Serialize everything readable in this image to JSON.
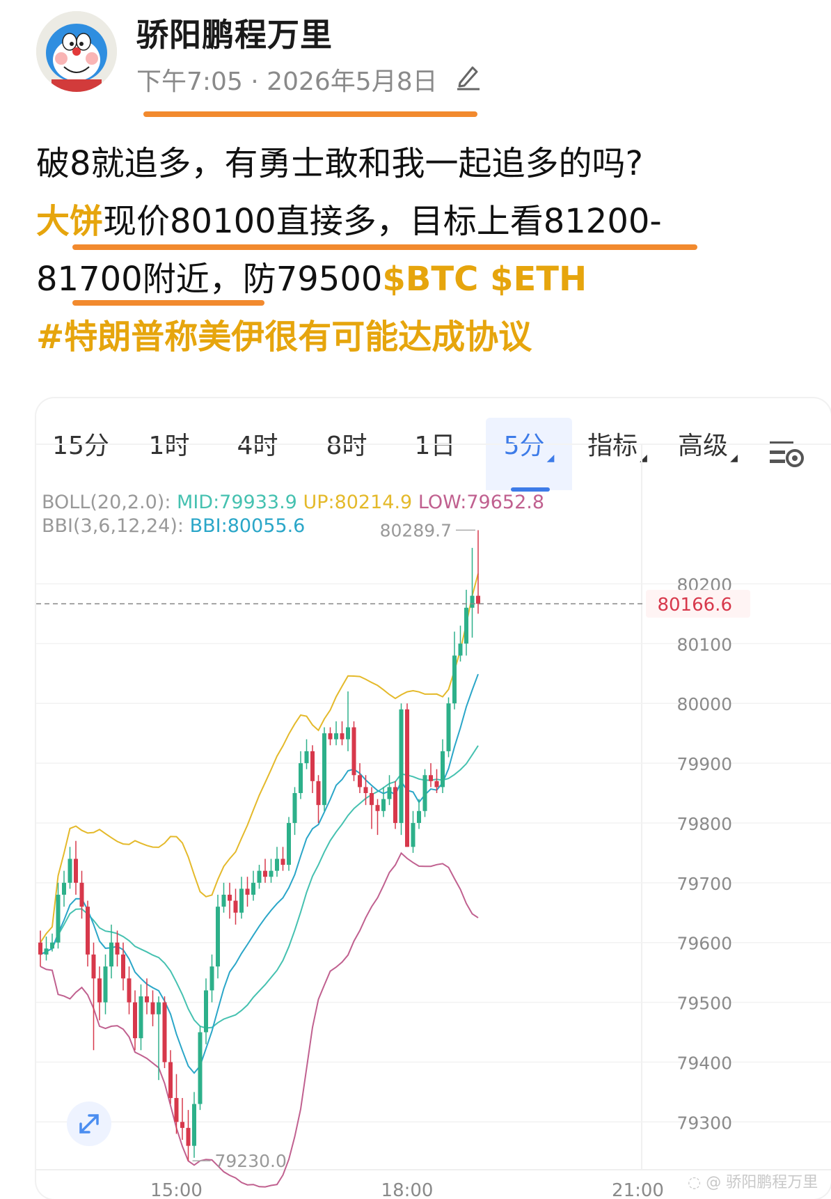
{
  "post": {
    "author": "骄阳鹏程万里",
    "meta": "下午7:05 · 2026年5月8日",
    "line1": "破8就追多，有勇士敢和我一起追多的吗?",
    "line2_hl": "大饼",
    "line2": "现价80100直接多，目标上看81200-",
    "line3": "81700附近，防79500",
    "line3_tags": "$BTC $ETH",
    "line4": "#特朗普称美伊很有可能达成协议"
  },
  "tabs": [
    {
      "label": "15分"
    },
    {
      "label": "1时"
    },
    {
      "label": "4时"
    },
    {
      "label": "8时"
    },
    {
      "label": "1日"
    },
    {
      "label": "5分",
      "active": true,
      "caret": true
    },
    {
      "label": "指标",
      "caret": true
    },
    {
      "label": "高级",
      "caret": true
    }
  ],
  "indicators": {
    "boll_label": "BOLL(20,2.0):",
    "boll_mid": "MID:79933.9",
    "boll_up": "UP:80214.9",
    "boll_low": "LOW:79652.8",
    "bbi_label": "BBI(3,6,12,24):",
    "bbi_value": "BBI:80055.6"
  },
  "colors": {
    "up": "#2db08a",
    "down": "#d7384b",
    "mid": "#45c1b0",
    "upper": "#e4b92a",
    "lower": "#c0608f",
    "bbi": "#2aa6c8",
    "accent": "#3d7be8",
    "gold": "#e6a50d",
    "highlight": "#f28a2e"
  },
  "chart_data": {
    "type": "candlestick",
    "symbol": "BTC",
    "interval": "5分",
    "y_ticks": [
      80200,
      80100,
      80000,
      79900,
      79800,
      79700,
      79600,
      79500,
      79400,
      79300
    ],
    "ylim": [
      79220,
      80310
    ],
    "x_ticks": [
      "15:00",
      "18:00",
      "21:00"
    ],
    "current_price": "80166.6",
    "current_price_value": 80166.6,
    "high_label": "80289.7",
    "low_label": "79230.0",
    "candles": [
      [
        79600,
        79580,
        79620,
        79560
      ],
      [
        79580,
        79590,
        79610,
        79570
      ],
      [
        79590,
        79600,
        79615,
        79585
      ],
      [
        79600,
        79680,
        79700,
        79590
      ],
      [
        79680,
        79700,
        79720,
        79660
      ],
      [
        79700,
        79740,
        79760,
        79690
      ],
      [
        79740,
        79700,
        79770,
        79680
      ],
      [
        79700,
        79660,
        79720,
        79640
      ],
      [
        79660,
        79580,
        79670,
        79560
      ],
      [
        79580,
        79540,
        79600,
        79420
      ],
      [
        79540,
        79500,
        79560,
        79470
      ],
      [
        79500,
        79560,
        79580,
        79480
      ],
      [
        79560,
        79600,
        79630,
        79540
      ],
      [
        79600,
        79580,
        79620,
        79560
      ],
      [
        79580,
        79540,
        79600,
        79520
      ],
      [
        79540,
        79500,
        79560,
        79480
      ],
      [
        79500,
        79440,
        79520,
        79420
      ],
      [
        79440,
        79510,
        79530,
        79420
      ],
      [
        79510,
        79500,
        79540,
        79480
      ],
      [
        79500,
        79480,
        79520,
        79460
      ],
      [
        79480,
        79500,
        79510,
        79370
      ],
      [
        79500,
        79400,
        79510,
        79390
      ],
      [
        79400,
        79340,
        79420,
        79330
      ],
      [
        79340,
        79300,
        79380,
        79280
      ],
      [
        79300,
        79290,
        79340,
        79270
      ],
      [
        79290,
        79260,
        79320,
        79235
      ],
      [
        79260,
        79330,
        79350,
        79240
      ],
      [
        79330,
        79450,
        79460,
        79320
      ],
      [
        79450,
        79520,
        79540,
        79430
      ],
      [
        79520,
        79560,
        79580,
        79500
      ],
      [
        79560,
        79660,
        79680,
        79540
      ],
      [
        79660,
        79680,
        79700,
        79650
      ],
      [
        79680,
        79670,
        79700,
        79640
      ],
      [
        79670,
        79650,
        79690,
        79630
      ],
      [
        79650,
        79690,
        79710,
        79640
      ],
      [
        79690,
        79680,
        79710,
        79660
      ],
      [
        79680,
        79700,
        79720,
        79670
      ],
      [
        79700,
        79720,
        79730,
        79690
      ],
      [
        79720,
        79710,
        79740,
        79700
      ],
      [
        79710,
        79720,
        79740,
        79700
      ],
      [
        79720,
        79740,
        79760,
        79710
      ],
      [
        79740,
        79730,
        79760,
        79720
      ],
      [
        79730,
        79800,
        79810,
        79720
      ],
      [
        79800,
        79850,
        79860,
        79780
      ],
      [
        79850,
        79900,
        79920,
        79840
      ],
      [
        79900,
        79920,
        79940,
        79890
      ],
      [
        79920,
        79870,
        79930,
        79850
      ],
      [
        79870,
        79830,
        79880,
        79800
      ],
      [
        79830,
        79950,
        79960,
        79820
      ],
      [
        79950,
        79940,
        79960,
        79930
      ],
      [
        79940,
        79950,
        79970,
        79930
      ],
      [
        79950,
        79940,
        79970,
        79930
      ],
      [
        79940,
        79960,
        80020,
        79920
      ],
      [
        79960,
        79880,
        79970,
        79870
      ],
      [
        79880,
        79860,
        79900,
        79850
      ],
      [
        79860,
        79850,
        79880,
        79830
      ],
      [
        79850,
        79830,
        79860,
        79790
      ],
      [
        79830,
        79820,
        79840,
        79780
      ],
      [
        79820,
        79840,
        79860,
        79810
      ],
      [
        79840,
        79860,
        79880,
        79830
      ],
      [
        79860,
        79800,
        79870,
        79790
      ],
      [
        79800,
        79990,
        80000,
        79780
      ],
      [
        79990,
        79760,
        80000,
        79760
      ],
      [
        79760,
        79800,
        79820,
        79750
      ],
      [
        79800,
        79820,
        79840,
        79790
      ],
      [
        79820,
        79880,
        79890,
        79810
      ],
      [
        79880,
        79870,
        79900,
        79860
      ],
      [
        79870,
        79860,
        79890,
        79850
      ],
      [
        79860,
        79920,
        79940,
        79850
      ],
      [
        79920,
        80000,
        80010,
        79910
      ],
      [
        80000,
        80080,
        80120,
        79990
      ],
      [
        80080,
        80100,
        80130,
        80070
      ],
      [
        80100,
        80160,
        80190,
        80080
      ],
      [
        80160,
        80180,
        80260,
        80110
      ],
      [
        80180,
        80166.6,
        80289.7,
        80150
      ]
    ]
  },
  "watermark": "骄阳鹏程万里"
}
